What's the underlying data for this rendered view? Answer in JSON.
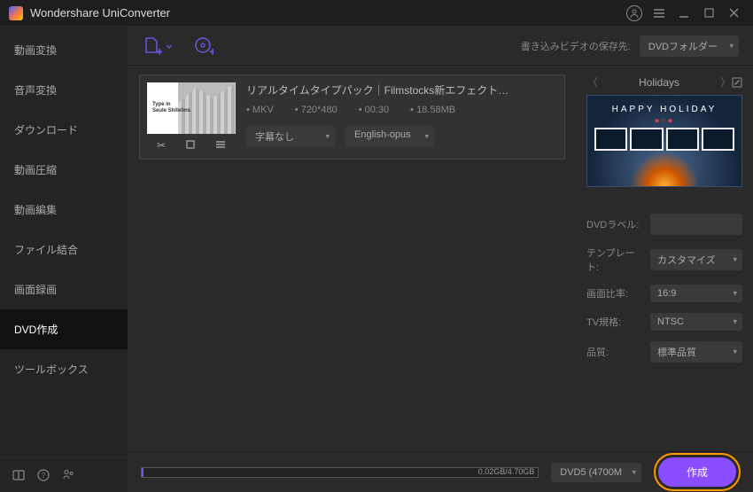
{
  "app": {
    "title": "Wondershare UniConverter"
  },
  "sidebar": {
    "items": [
      {
        "label": "動画変換"
      },
      {
        "label": "音声変換"
      },
      {
        "label": "ダウンロード"
      },
      {
        "label": "動画圧縮"
      },
      {
        "label": "動画編集"
      },
      {
        "label": "ファイル結合"
      },
      {
        "label": "画面録画"
      },
      {
        "label": "DVD作成"
      },
      {
        "label": "ツールボックス"
      }
    ],
    "active_index": 7
  },
  "toolbar": {
    "save_label": "書き込みビデオの保存先:",
    "save_dest": "DVDフォルダー"
  },
  "video": {
    "title": "リアルタイムタイプパック｜Filmstocks新エフェクト…",
    "thumb_text1": "Type in",
    "thumb_text2": "Seule Shitehns",
    "format": "MKV",
    "resolution": "720*480",
    "duration": "00:30",
    "size": "18.58MB",
    "subtitle_select": "字幕なし",
    "audio_select": "English-opus"
  },
  "template": {
    "name": "Holidays",
    "preview_title": "HAPPY HOLIDAY"
  },
  "options": {
    "dvd_label_label": "DVDラベル:",
    "dvd_label_value": "",
    "template_label": "テンプレート:",
    "template_value": "カスタマイズ",
    "aspect_label": "画面比率:",
    "aspect_value": "16:9",
    "tv_label": "TV規格:",
    "tv_value": "NTSC",
    "quality_label": "品質:",
    "quality_value": "標準品質"
  },
  "footer": {
    "capacity_text": "0.02GB/4.70GB",
    "disc_select": "DVD5 (4700M",
    "create_btn": "作成"
  }
}
